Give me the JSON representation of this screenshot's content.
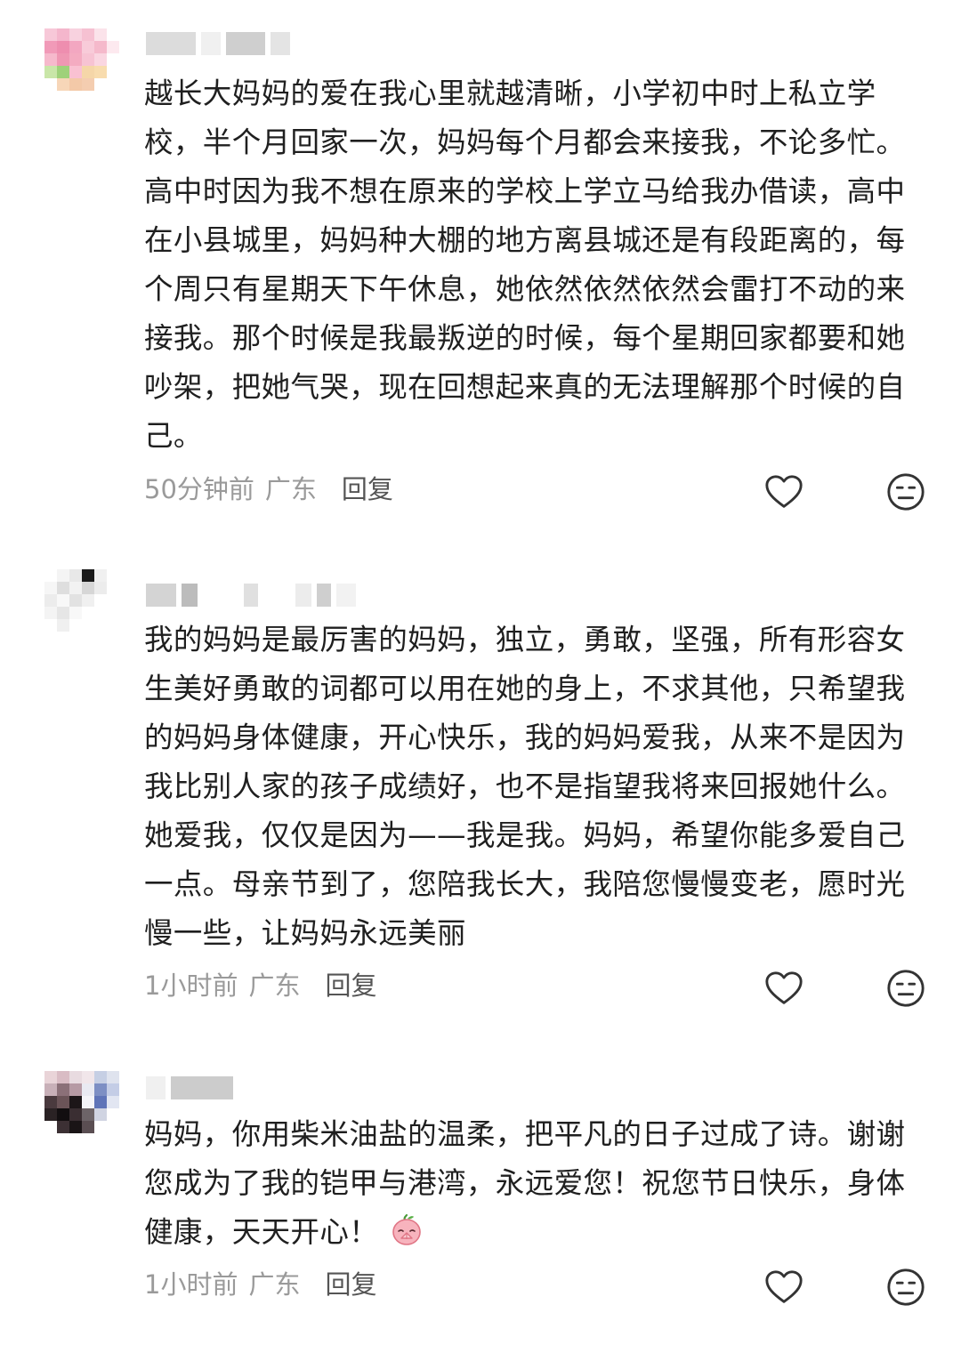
{
  "comments": [
    {
      "text": "越长大妈妈的爱在我心里就越清晰，小学初中时上私立学校，半个月回家一次，妈妈每个月都会来接我，不论多忙。高中时因为我不想在原来的学校上学立马给我办借读，高中在小县城里，妈妈种大棚的地方离县城还是有段距离的，每个周只有星期天下午休息，她依然依然依然会雷打不动的来接我。那个时候是我最叛逆的时候，每个星期回家都要和她吵架，把她气哭，现在回想起来真的无法理解那个时候的自己。",
      "time": "50分钟前",
      "location": "广东",
      "reply": "回复"
    },
    {
      "text": "我的妈妈是最厉害的妈妈，独立，勇敢，坚强，所有形容女生美好勇敢的词都可以用在她的身上，不求其他，只希望我的妈妈身体健康，开心快乐，我的妈妈爱我，从来不是因为我比别人家的孩子成绩好，也不是指望我将来回报她什么。她爱我，仅仅是因为——我是我。妈妈，希望你能多爱自己一点。母亲节到了，您陪我长大，我陪您慢慢变老，愿时光慢一些，让妈妈永远美丽",
      "time": "1小时前",
      "location": "广东",
      "reply": "回复"
    },
    {
      "text": "妈妈，你用柴米油盐的温柔，把平凡的日子过成了诗。谢谢您成为了我的铠甲与港湾，永远爱您！祝您节日快乐，身体健康，天天开心！",
      "time": "1小时前",
      "location": "广东",
      "reply": "回复",
      "emoji": "praying-peach-emoji"
    }
  ],
  "icons": {
    "like": "heart-outline-icon",
    "dislike": "neutral-face-icon"
  },
  "colors": {
    "text": "#1f1f1f",
    "meta": "#9a9a9a",
    "reply": "#555555",
    "icon": "#333333"
  }
}
